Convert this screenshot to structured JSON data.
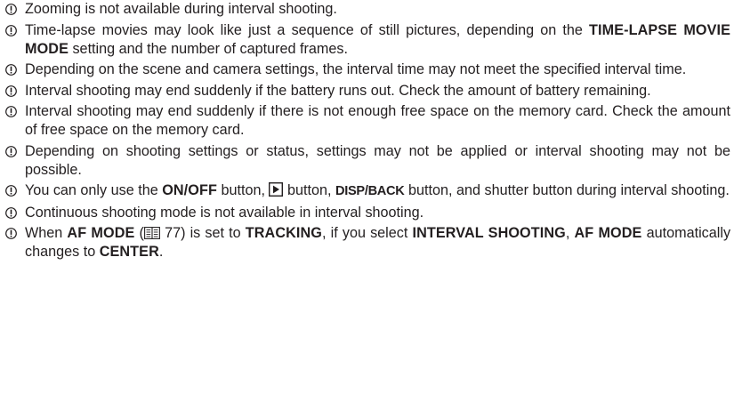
{
  "icons": {
    "note_icon": "caution-icon",
    "playback_icon": "playback-button-icon",
    "page_ref_icon": "book-reference-icon"
  },
  "notes": [
    {
      "segments": [
        {
          "t": "Zooming is not available during interval shooting.",
          "s": "n"
        }
      ]
    },
    {
      "segments": [
        {
          "t": "Time-lapse movies may look like just a sequence of still pictures, depending on the ",
          "s": "n"
        },
        {
          "t": "TIME-LAPSE MOVIE MODE",
          "s": "b"
        },
        {
          "t": " setting and the number of captured frames.",
          "s": "n"
        }
      ]
    },
    {
      "segments": [
        {
          "t": "Depending on the scene and camera settings, the interval time may not meet the specified interval time.",
          "s": "n"
        }
      ]
    },
    {
      "segments": [
        {
          "t": "Interval shooting may end suddenly if the battery runs out. Check the amount of battery remaining.",
          "s": "n"
        }
      ]
    },
    {
      "segments": [
        {
          "t": "Interval shooting may end suddenly if there is not enough free space on the memory card. Check the amount of free space on the memory card.",
          "s": "n"
        }
      ]
    },
    {
      "segments": [
        {
          "t": "Depending on shooting settings or status, settings may not be applied or interval shooting may not be possible.",
          "s": "n"
        }
      ]
    },
    {
      "segments": [
        {
          "t": "You can only use the ",
          "s": "n"
        },
        {
          "t": "ON/OFF",
          "s": "b"
        },
        {
          "t": " button, ",
          "s": "n"
        },
        {
          "t": "",
          "s": "play"
        },
        {
          "t": " button, ",
          "s": "n"
        },
        {
          "t": "DISP/BACK",
          "s": "c"
        },
        {
          "t": " button, and shutter button during interval shooting.",
          "s": "n"
        }
      ]
    },
    {
      "segments": [
        {
          "t": "Continuous shooting mode is not available in interval shooting.",
          "s": "n"
        }
      ]
    },
    {
      "segments": [
        {
          "t": "When ",
          "s": "n"
        },
        {
          "t": "AF MODE",
          "s": "b"
        },
        {
          "t": " (",
          "s": "n"
        },
        {
          "t": "",
          "s": "book"
        },
        {
          "t": " 77) is set to ",
          "s": "n"
        },
        {
          "t": "TRACKING",
          "s": "b"
        },
        {
          "t": ", if you select ",
          "s": "n"
        },
        {
          "t": "INTERVAL SHOOTING",
          "s": "b"
        },
        {
          "t": ", ",
          "s": "n"
        },
        {
          "t": "AF MODE",
          "s": "b"
        },
        {
          "t": " automatically changes to ",
          "s": "n"
        },
        {
          "t": "CENTER",
          "s": "b"
        },
        {
          "t": ".",
          "s": "n"
        }
      ]
    }
  ]
}
